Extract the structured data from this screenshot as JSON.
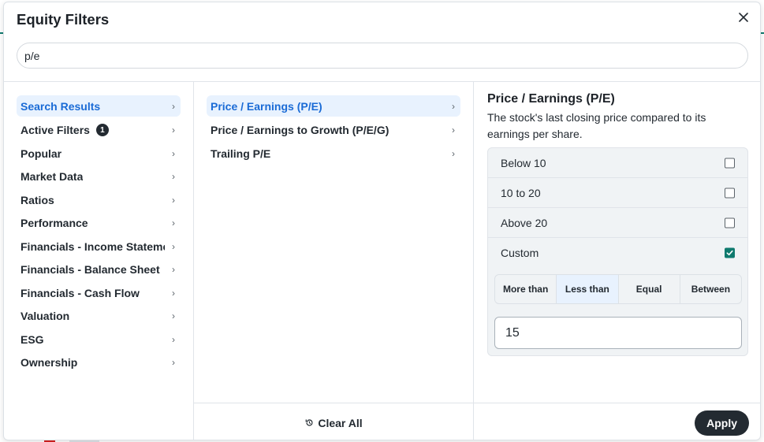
{
  "dialog": {
    "title": "Equity Filters",
    "close_icon": "close-icon"
  },
  "search": {
    "value": "p/e",
    "icon": "none"
  },
  "categories": [
    {
      "label": "Search Results",
      "active": true
    },
    {
      "label": "Active Filters",
      "badge": "1"
    },
    {
      "label": "Popular"
    },
    {
      "label": "Market Data"
    },
    {
      "label": "Ratios"
    },
    {
      "label": "Performance"
    },
    {
      "label": "Financials - Income Statement"
    },
    {
      "label": "Financials - Balance Sheet"
    },
    {
      "label": "Financials - Cash Flow"
    },
    {
      "label": "Valuation"
    },
    {
      "label": "ESG"
    },
    {
      "label": "Ownership"
    }
  ],
  "results": [
    {
      "label": "Price / Earnings (P/E)",
      "active": true
    },
    {
      "label": "Price / Earnings to Growth (P/E/G)"
    },
    {
      "label": "Trailing P/E"
    }
  ],
  "detail": {
    "title": "Price / Earnings (P/E)",
    "description": "The stock's last closing price compared to its earnings per share.",
    "options": [
      {
        "label": "Below 10",
        "checked": false
      },
      {
        "label": "10 to 20",
        "checked": false
      },
      {
        "label": "Above 20",
        "checked": false
      },
      {
        "label": "Custom",
        "checked": true
      }
    ],
    "comparators": [
      {
        "label": "More than"
      },
      {
        "label": "Less than",
        "selected": true
      },
      {
        "label": "Equal"
      },
      {
        "label": "Between"
      }
    ],
    "custom_value": "15"
  },
  "footer": {
    "clear_label": "Clear All",
    "clear_icon": "reset-icon",
    "apply_label": "Apply"
  },
  "colors": {
    "accent_blue": "#1a6bd6",
    "selected_bg": "#e8f2fe",
    "checkbox_green": "#0f7a6e",
    "dark_button": "#232a31"
  }
}
